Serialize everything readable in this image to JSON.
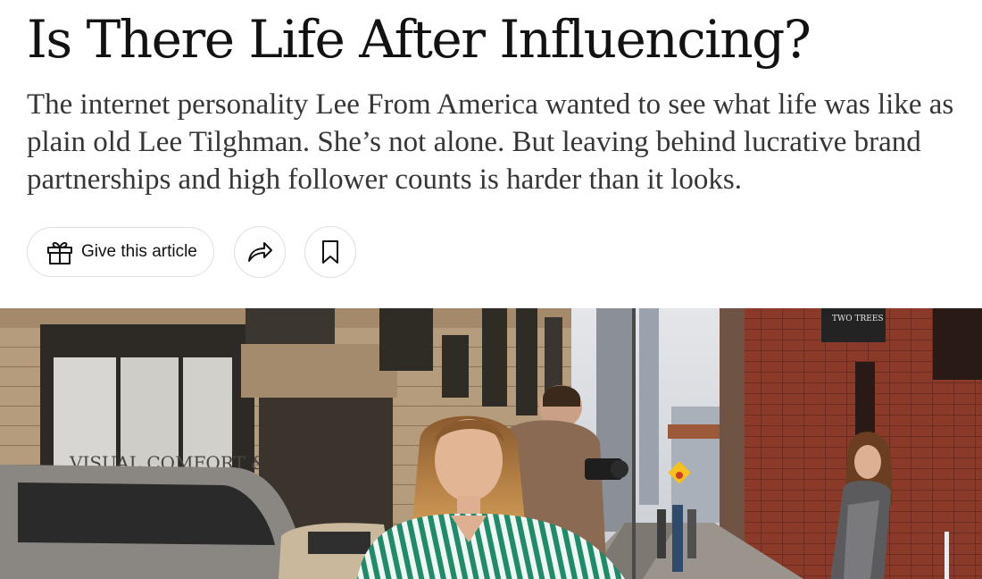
{
  "article": {
    "headline": "Is There Life After Influencing?",
    "summary": "The internet personality Lee From America wanted to see what life was like as plain old Lee Tilghman. She’s not alone. But leaving behind lucrative brand partnerships and high follower counts is harder than it looks."
  },
  "actions": {
    "gift_label": "Give this article",
    "gift_icon": "gift-icon",
    "share_icon": "share-icon",
    "save_icon": "bookmark-icon"
  },
  "photo": {
    "storefront_sign": "VISUAL COMFORT & CO.",
    "hanging_sign": "TWO TREES"
  },
  "colors": {
    "text": "#121212",
    "summary_text": "#363636",
    "button_border": "#dfdfdf",
    "brick": "#8b3a2a",
    "sandstone": "#b59c7c"
  }
}
